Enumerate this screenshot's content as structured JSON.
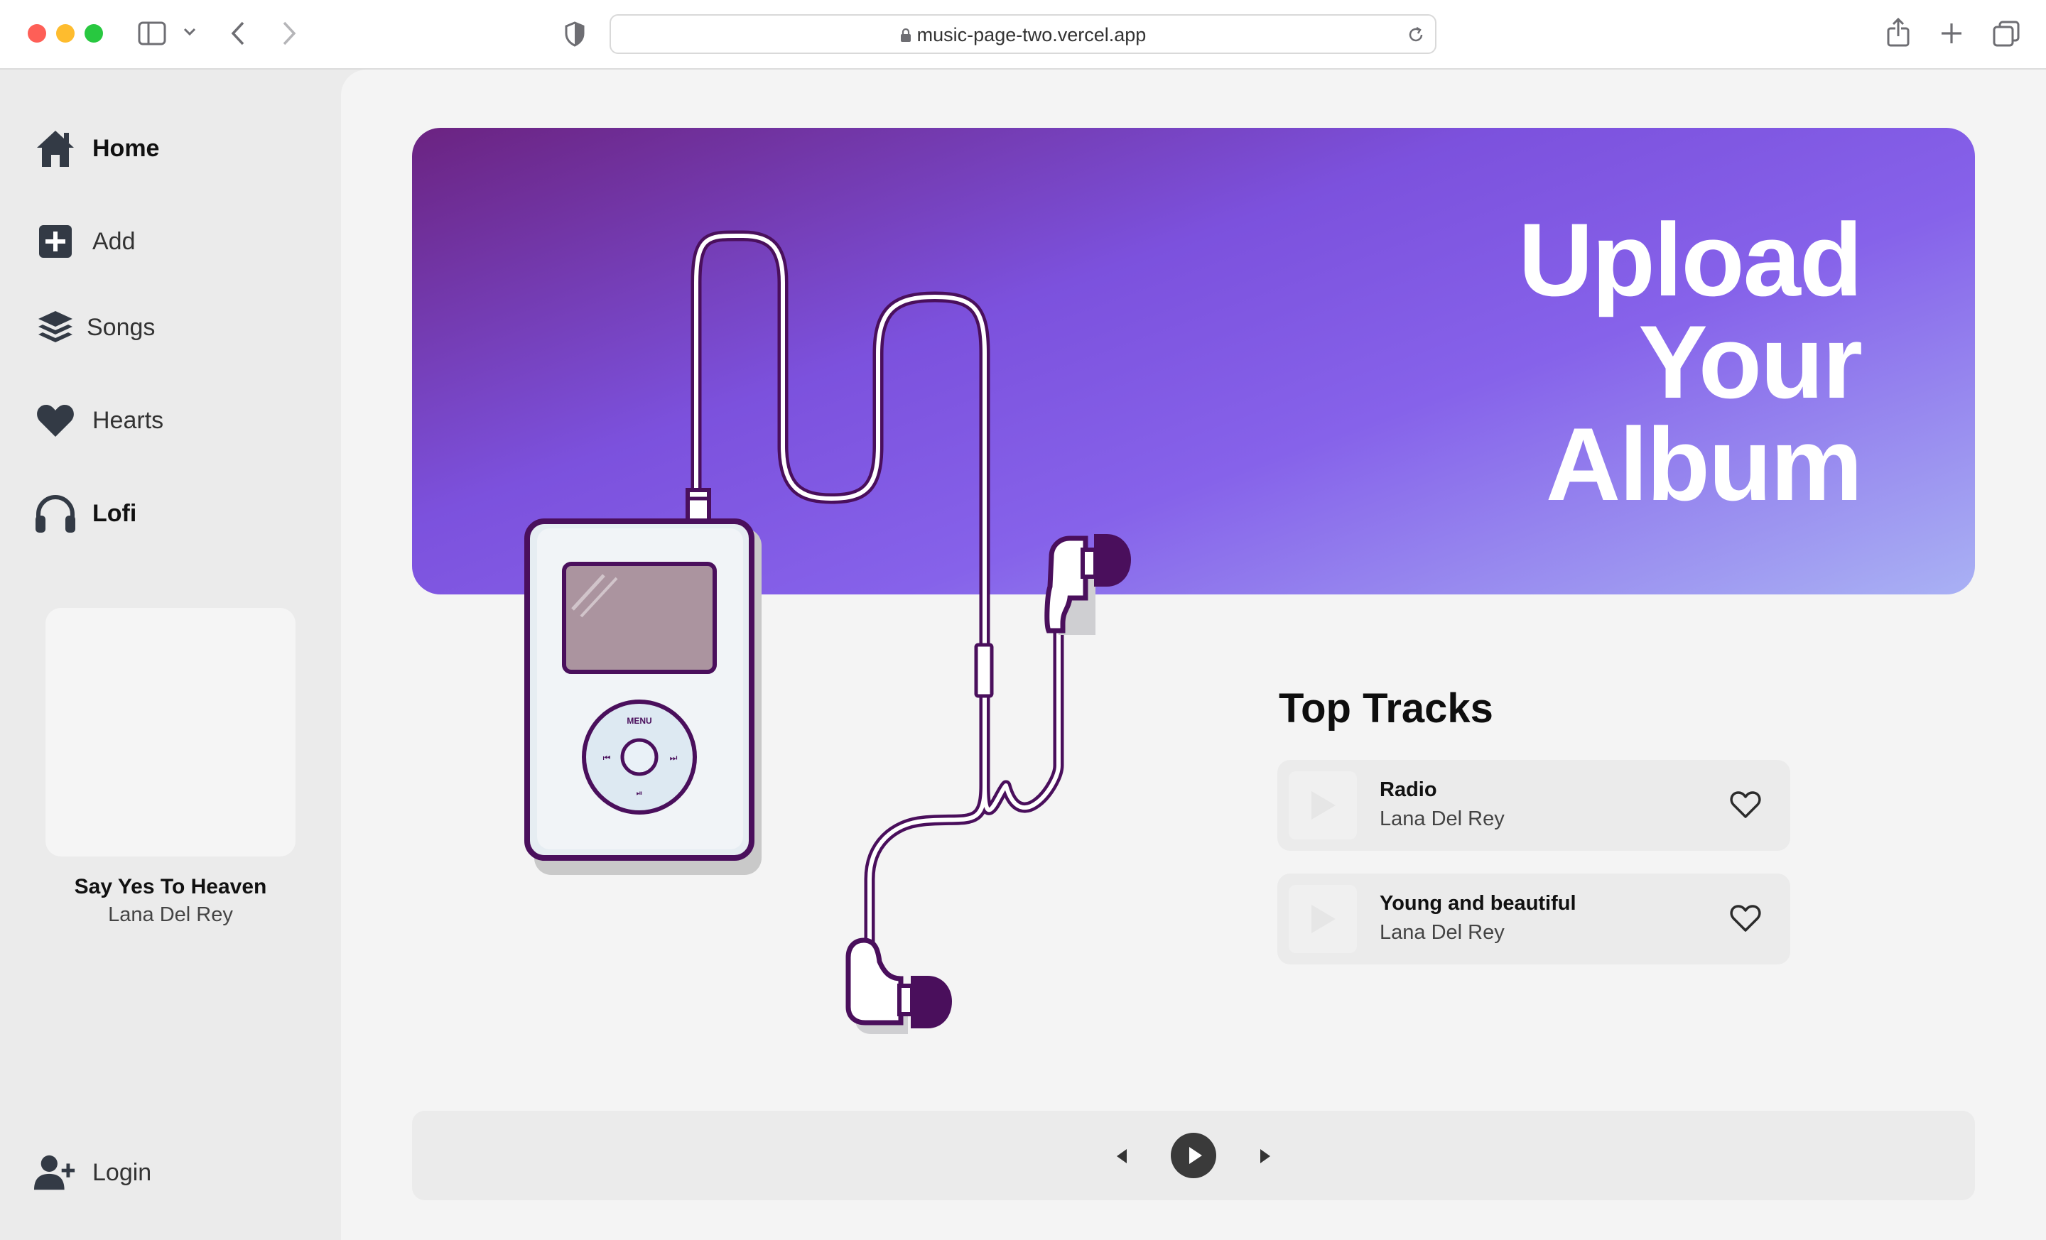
{
  "browser": {
    "url": "music-page-two.vercel.app"
  },
  "sidebar": {
    "items": [
      {
        "label": "Home",
        "icon": "home-icon"
      },
      {
        "label": "Add",
        "icon": "plus-square-icon"
      },
      {
        "label": "Songs",
        "icon": "layers-icon"
      },
      {
        "label": "Hearts",
        "icon": "heart-icon"
      },
      {
        "label": "Lofi",
        "icon": "headphones-icon"
      }
    ],
    "now_playing": {
      "title": "Say Yes To Heaven",
      "artist": "Lana Del Rey"
    },
    "login_label": "Login"
  },
  "hero": {
    "title_lines": [
      "Upload",
      "Your",
      "Album"
    ]
  },
  "ipod": {
    "menu_label": "MENU"
  },
  "top_tracks": {
    "heading": "Top Tracks",
    "tracks": [
      {
        "title": "Radio",
        "artist": "Lana Del Rey"
      },
      {
        "title": "Young and beautiful",
        "artist": "Lana Del Rey"
      }
    ]
  },
  "colors": {
    "accent_purple": "#7c51dd",
    "dark_purple": "#4a0f5c",
    "icon_gray": "#333a45"
  }
}
